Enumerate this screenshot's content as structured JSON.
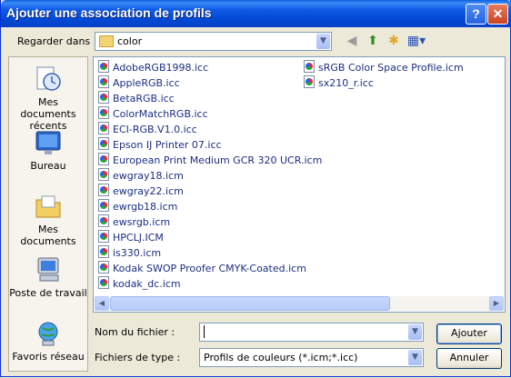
{
  "window": {
    "title": "Ajouter une association de profils",
    "help_label": "?",
    "close_label": "✕"
  },
  "lookin": {
    "label": "Regarder dans :",
    "value": "color",
    "arrow": "▼"
  },
  "toolbar": {
    "back_icon": "back-arrow-icon",
    "up_icon": "up-folder-icon",
    "new_folder_icon": "new-folder-icon",
    "view_icon": "view-menu-icon",
    "back_glyph": "◀",
    "up_glyph": "⬆",
    "new_glyph": "✱",
    "view_glyph": "▦▾"
  },
  "places": [
    {
      "label": "Mes documents récents",
      "icon": "recent-documents-icon"
    },
    {
      "label": "Bureau",
      "icon": "desktop-icon"
    },
    {
      "label": "Mes documents",
      "icon": "my-documents-icon"
    },
    {
      "label": "Poste de travail",
      "icon": "my-computer-icon"
    },
    {
      "label": "Favoris réseau",
      "icon": "network-places-icon"
    }
  ],
  "files_col1": [
    "AdobeRGB1998.icc",
    "AppleRGB.icc",
    "BetaRGB.icc",
    "ColorMatchRGB.icc",
    "ECI-RGB.V1.0.icc",
    "Epson IJ Printer 07.icc",
    "European Print Medium GCR 320 UCR.icm",
    "ewgray18.icm",
    "ewgray22.icm",
    "ewrgb18.icm",
    "ewsrgb.icm",
    "HPCLJ.ICM",
    "is330.icm",
    "Kodak SWOP Proofer CMYK-Coated.icm",
    "kodak_dc.icm"
  ],
  "files_col2": [
    "sRGB Color Space Profile.icm",
    "sx210_r.icc"
  ],
  "scroll": {
    "left": "◀",
    "right": "▶"
  },
  "filename": {
    "label": "Nom du fichier :",
    "value": ""
  },
  "filetype": {
    "label": "Fichiers de type :",
    "value": "Profils de couleurs (*.icm;*.icc)"
  },
  "buttons": {
    "ok": "Ajouter",
    "cancel": "Annuler"
  },
  "colors": {
    "title_bar": "#0349d4",
    "dialog_bg": "#ece9d8",
    "file_text": "#1c2e82"
  }
}
